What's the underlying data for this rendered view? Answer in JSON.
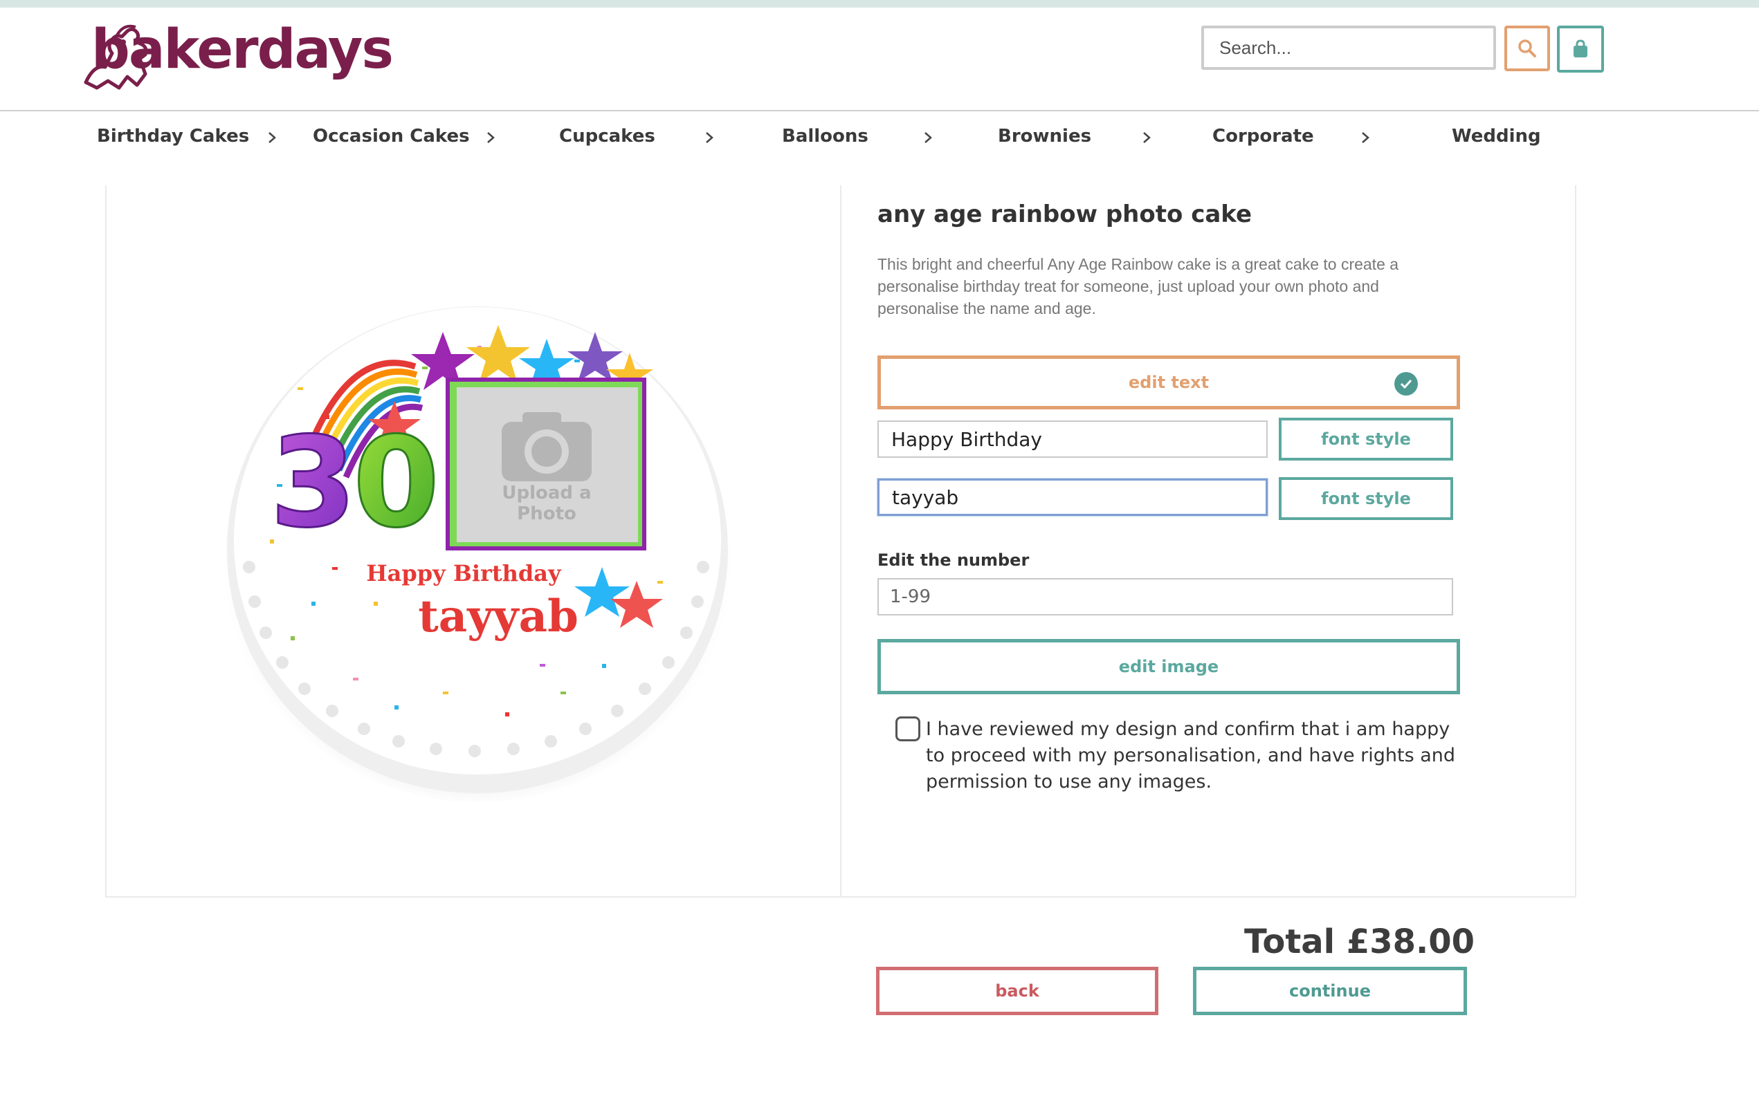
{
  "brand": {
    "name": "bakerdays",
    "color": "#7a1f4b"
  },
  "header": {
    "search_placeholder": "Search...",
    "search_icon": "search-icon",
    "cart_icon": "shopping-bag-icon"
  },
  "nav": {
    "items": [
      {
        "label": "Birthday Cakes"
      },
      {
        "label": "Occasion Cakes"
      },
      {
        "label": "Cupcakes"
      },
      {
        "label": "Balloons"
      },
      {
        "label": "Brownies"
      },
      {
        "label": "Corporate"
      },
      {
        "label": "Wedding"
      }
    ]
  },
  "preview": {
    "age_number": "30",
    "upload_label": "Upload a Photo",
    "line1": "Happy Birthday",
    "line2": "tayyab"
  },
  "product": {
    "title": "any age rainbow photo cake",
    "description": "This bright and cheerful Any Age Rainbow cake is a great cake to create a personalise birthday treat for someone, just upload your own photo and personalise the name and age."
  },
  "editor": {
    "edit_text_label": "edit text",
    "text_line1_value": "Happy Birthday",
    "text_line2_value": "tayyab",
    "font_style_label": "font style",
    "number_label": "Edit the number",
    "number_placeholder": "1-99",
    "edit_image_label": "edit image",
    "confirm_text": "I have reviewed my design and confirm that i am happy to proceed with my personalisation, and have rights and permission to use any images."
  },
  "footer": {
    "total": "Total £38.00",
    "back_label": "back",
    "continue_label": "continue"
  },
  "colors": {
    "accent_orange": "#e2a06f",
    "accent_teal": "#5ba89f",
    "accent_red": "#d16e72"
  }
}
